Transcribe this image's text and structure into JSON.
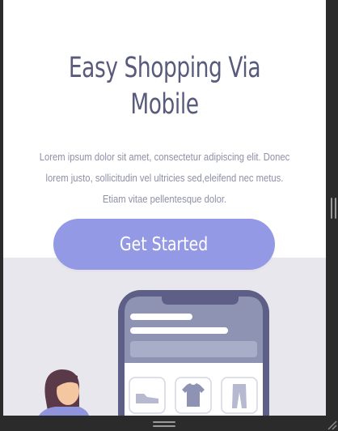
{
  "hero": {
    "title_line1": "Easy Shopping Via",
    "title_line2": "Mobile",
    "desc_line1": "Lorem ipsum dolor sit amet, consectetur adipiscing elit. Donec",
    "desc_line2": "lorem justo, sollicitudin vel ultricies sed,eleifend nec metus.",
    "desc_line3": "Etiam vitae pellentesque dolor."
  },
  "cta": {
    "label": "Get Started"
  },
  "colors": {
    "title": "#585b7c",
    "text": "#8e8fa6",
    "accent": "#9499e6",
    "band": "#e8e7ee",
    "phone": "#5d5f86"
  },
  "illustration": {
    "icons": [
      "shoe-icon",
      "shirt-icon",
      "pants-icon"
    ]
  }
}
